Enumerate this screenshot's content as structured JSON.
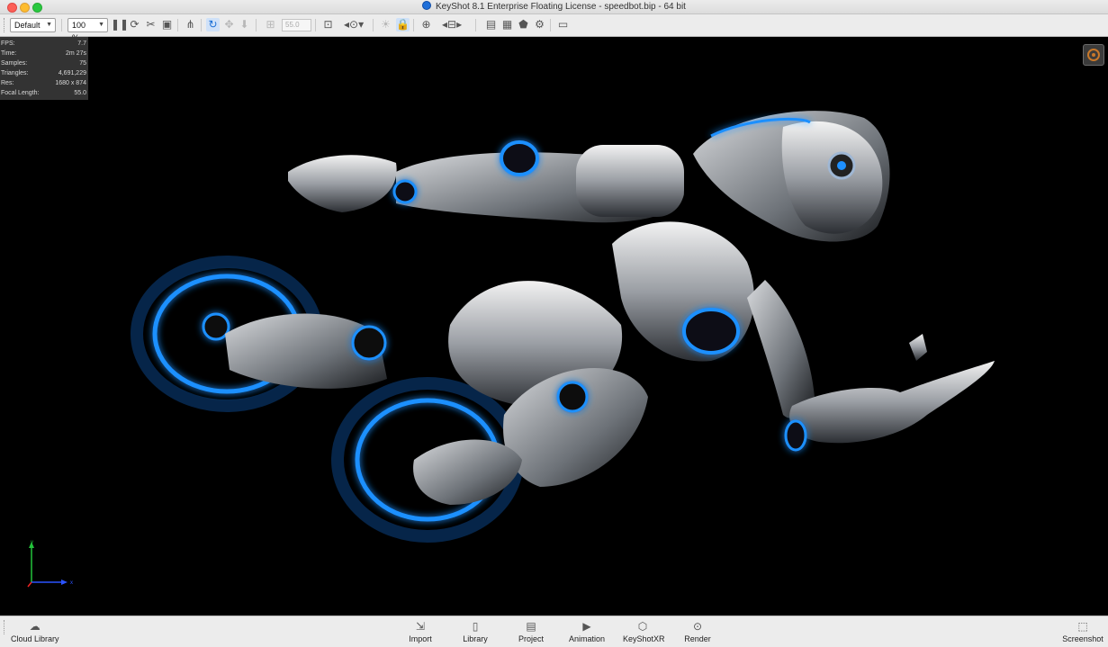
{
  "window": {
    "title": "KeyShot 8.1 Enterprise Floating License  - speedbot.bip  - 64 bit"
  },
  "toolbar": {
    "camera_select": "Default",
    "zoom_select": "100 %",
    "focal_value": "55.0",
    "icons": [
      "pause-icon",
      "performance-mode-icon",
      "tumble-icon",
      "region-icon",
      "geometry-view-icon",
      "rotate-icon",
      "pan-icon",
      "dolly-icon",
      "lock-camera-icon",
      "add-camera-icon",
      "screenshot-tool-icon",
      "sun-icon",
      "lock-environment-icon",
      "add-sun-icon",
      "studio-icon",
      "scene-tree-icon",
      "materials-icon",
      "environments-icon",
      "textures-icon",
      "presentation-icon"
    ]
  },
  "stats": [
    {
      "label": "FPS:",
      "value": "7.7"
    },
    {
      "label": "Time:",
      "value": "2m 27s"
    },
    {
      "label": "Samples:",
      "value": "75"
    },
    {
      "label": "Triangles:",
      "value": "4,691,229"
    },
    {
      "label": "Res:",
      "value": "1680 x 874"
    },
    {
      "label": "Focal Length:",
      "value": "55.0"
    }
  ],
  "axes": {
    "y": "y",
    "x": "x"
  },
  "bottombar": {
    "cloud_library": "Cloud Library",
    "import": "Import",
    "library": "Library",
    "project": "Project",
    "animation": "Animation",
    "keyshotxr": "KeyShotXR",
    "render": "Render",
    "screenshot": "Screenshot"
  },
  "colors": {
    "glow": "#1e90ff",
    "viewport_bg": "#000000",
    "toolbar_bg": "#ececec"
  }
}
